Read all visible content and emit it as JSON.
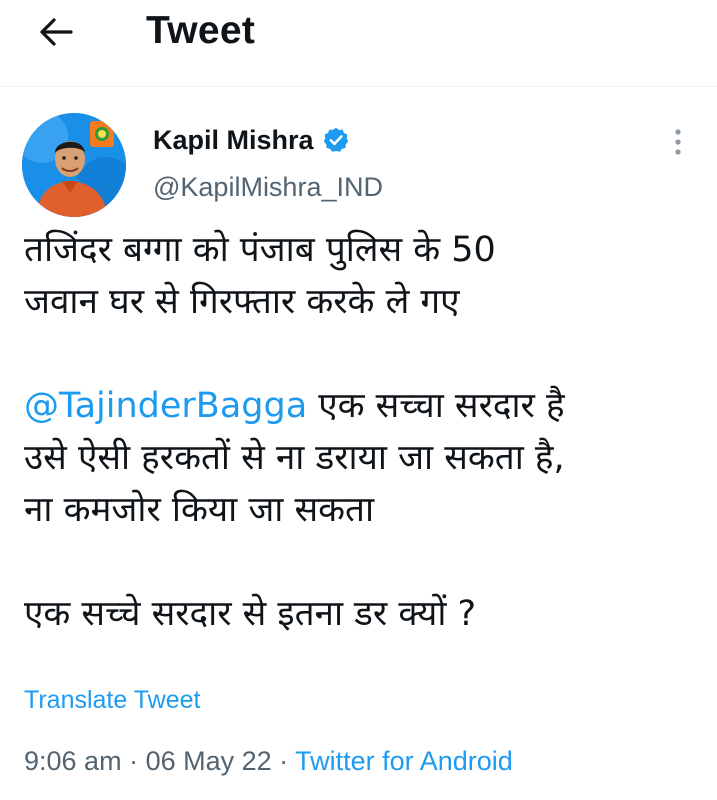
{
  "header": {
    "back_icon": "arrow-left-icon",
    "title": "Tweet"
  },
  "author": {
    "name": "Kapil Mishra",
    "handle": "@KapilMishra_IND",
    "verified_icon": "verified-badge-icon",
    "verified_color": "#1d9bf0"
  },
  "more_icon": "vertical-ellipsis-icon",
  "tweet": {
    "lines": [
      "तजिंदर बग्गा को पंजाब पुलिस के 50",
      "जवान घर से गिरफ्तार करके ले गए"
    ],
    "mention": "@TajinderBagga",
    "mention_line_rest": " एक सच्चा सरदार है",
    "lines_after_mention": [
      "उसे ऐसी हरकतों से ना डराया जा सकता है,",
      "ना कमजोर किया जा सकता"
    ],
    "closing_line": "एक सच्चे सरदार से इतना डर क्यों ?"
  },
  "translate_label": "Translate Tweet",
  "meta": {
    "time": "9:06 am",
    "separator": " · ",
    "date": "06 May 22",
    "source": "Twitter for Android"
  },
  "colors": {
    "accent": "#1d9bf0",
    "secondary_text": "#536471",
    "primary_text": "#0f1419"
  }
}
